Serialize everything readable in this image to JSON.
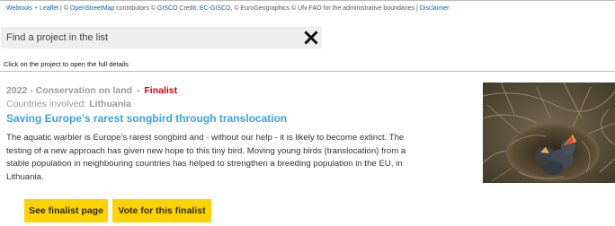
{
  "map_attribution": {
    "webtools": "Webtools",
    "plus": " + ",
    "leaflet": "Leaflet",
    "sep1": " | © ",
    "osm": "OpenStreetMap",
    "contributors": " contributors © ",
    "gisco": "GISCO",
    "credit": " Credit: ",
    "ec_gisco": "EC-GISCO",
    "rest": ", © EuroGeographics © UN-FAO for the administrative boundaries | ",
    "disclaimer": "Disclaimer"
  },
  "search": {
    "placeholder": "Find a project in the list",
    "clear_icon": "close-x-icon"
  },
  "hint": "Click on the project to open the full details",
  "project": {
    "year_category": "2022 - Conservation on land",
    "separator": "-",
    "status": "Finalist",
    "countries_label": "Countries involved: ",
    "countries_value": "Lithuania",
    "title": "Saving Europe’s rarest songbird through translocation",
    "description": "The aquatic warbler is Europe’s rarest songbird and - without our help - it is likely to become extinct. The testing of a new approach has given new hope to this tiny bird. Moving young birds (translocation) from a stable population in neighbouring countries has helped to strengthen a breeding population in the EU, in Lithuania.",
    "image": "aquatic-warbler-chicks-in-nest-photo"
  },
  "buttons": {
    "finalist_page": "See finalist page",
    "vote": "Vote for this finalist"
  },
  "colors": {
    "accent_yellow": "#ffd200",
    "title_blue": "#3aa3dd",
    "finalist_red": "#d4000f",
    "meta_grey": "#9a9a9a"
  }
}
